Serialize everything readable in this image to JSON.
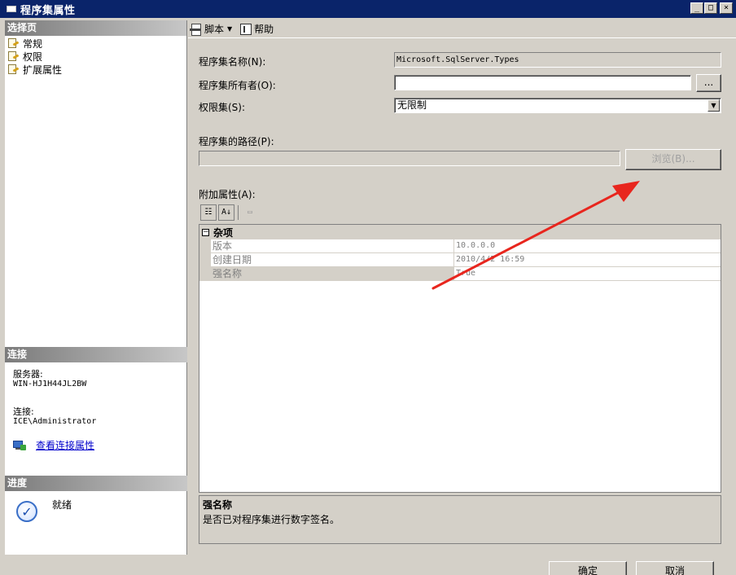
{
  "window": {
    "title": "程序集属性",
    "buttons": {
      "minimize": "_",
      "maximize": "□",
      "close": "×"
    }
  },
  "left": {
    "select_page_header": "选择页",
    "nav_items": [
      {
        "label": "常规",
        "icon": "page-icon"
      },
      {
        "label": "权限",
        "icon": "page-icon"
      },
      {
        "label": "扩展属性",
        "icon": "page-icon"
      }
    ],
    "connection": {
      "header": "连接",
      "server_label": "服务器:",
      "server_value": "WIN-HJ1H44JL2BW",
      "conn_label": "连接:",
      "conn_value": "ICE\\Administrator",
      "link_text": "查看连接属性"
    },
    "progress": {
      "header": "进度",
      "status": "就绪"
    }
  },
  "toolbar": {
    "script_label": "脚本",
    "help_label": "帮助"
  },
  "form": {
    "name_label": "程序集名称(N):",
    "name_value": "Microsoft.SqlServer.Types",
    "owner_label": "程序集所有者(O):",
    "owner_value": "",
    "owner_browse": "...",
    "permset_label": "权限集(S):",
    "permset_value": "无限制",
    "path_label": "程序集的路径(P):",
    "path_value": "",
    "browse_label": "浏览(B)...",
    "extra_label": "附加属性(A):"
  },
  "grid": {
    "category": "杂项",
    "category_toggle": "⊟",
    "rows": [
      {
        "name": "版本",
        "value": "10.0.0.0"
      },
      {
        "name": "创建日期",
        "value": "2010/4/2 16:59"
      },
      {
        "name": "强名称",
        "value": "True"
      }
    ]
  },
  "description": {
    "title": "强名称",
    "text": "是否已对程序集进行数字签名。"
  },
  "dialog_buttons": {
    "ok": "确定",
    "cancel": "取消"
  },
  "colors": {
    "titlebar": "#0a246a",
    "annotation_arrow": "#e8261e"
  }
}
